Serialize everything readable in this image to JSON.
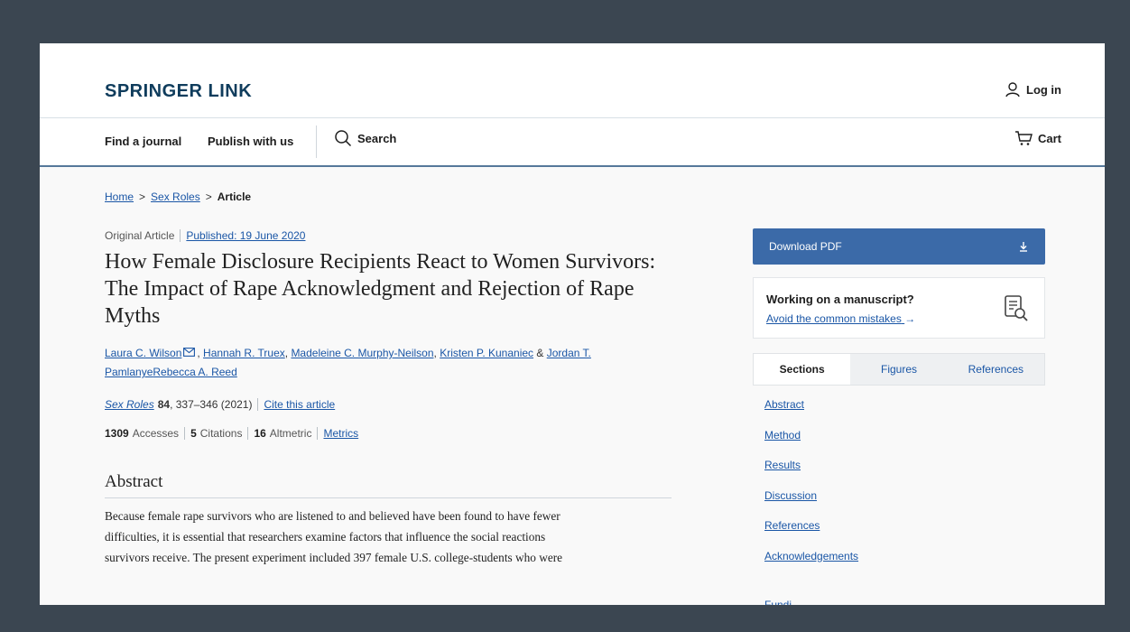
{
  "brand": {
    "logo": "SPRINGER LINK",
    "login_label": "Log in"
  },
  "nav": {
    "items": [
      "Find a journal",
      "Publish with us"
    ],
    "search_label": "Search",
    "cart_label": "Cart"
  },
  "breadcrumb": {
    "home": "Home",
    "sep1": ">",
    "journal": "Sex Roles",
    "sep2": ">",
    "current": "Article"
  },
  "article": {
    "type": "Original Article",
    "published": "Published: 19 June 2020",
    "title": "How Female Disclosure Recipients React to Women Survivors: The Impact of Rape Acknowledgment and Rejection of Rape Myths",
    "authors": [
      "Laura C. Wilson",
      "Hannah R. Truex",
      "Madeleine C. Murphy-Neilson",
      "Kristen P. Kunaniec",
      "Jordan T. Pamlanye",
      "Rebecca A. Reed"
    ],
    "author_seps": [
      ", ",
      ", ",
      ", ",
      " & "
    ],
    "journal_name": "Sex Roles",
    "volume": "84",
    "pages": ", 337–346 (2021)",
    "cite_label": "Cite this article",
    "metrics": {
      "accesses_count": "1309",
      "accesses_label": "Accesses",
      "citations_count": "5",
      "citations_label": "Citations",
      "altmetric_count": "16",
      "altmetric_label": "Altmetric",
      "metrics_link": "Metrics"
    },
    "abstract_heading": "Abstract",
    "abstract_lines": [
      "Because female rape survivors who are listened to and believed have been found to have fewer",
      "difficulties, it is essential that researchers examine factors that influence the social reactions",
      "survivors receive. The present experiment included 397 female U.S. college-students who were"
    ]
  },
  "sidebar": {
    "download_label": "Download PDF",
    "download_icon": "download-icon",
    "manuscript_title": "Working on a manuscript?",
    "manuscript_link": "Avoid the common mistakes",
    "tabs": [
      "Sections",
      "Figures",
      "References"
    ],
    "sections": [
      "Abstract",
      "Method",
      "Results",
      "Discussion",
      "References",
      "Acknowledgements"
    ],
    "truncated_section": "Funding"
  },
  "colors": {
    "backdrop": "#3b4651",
    "brand": "#0f3c5c",
    "link": "#1a56a6",
    "download_button": "#3b6aa8",
    "nav_underline": "#55789a"
  }
}
